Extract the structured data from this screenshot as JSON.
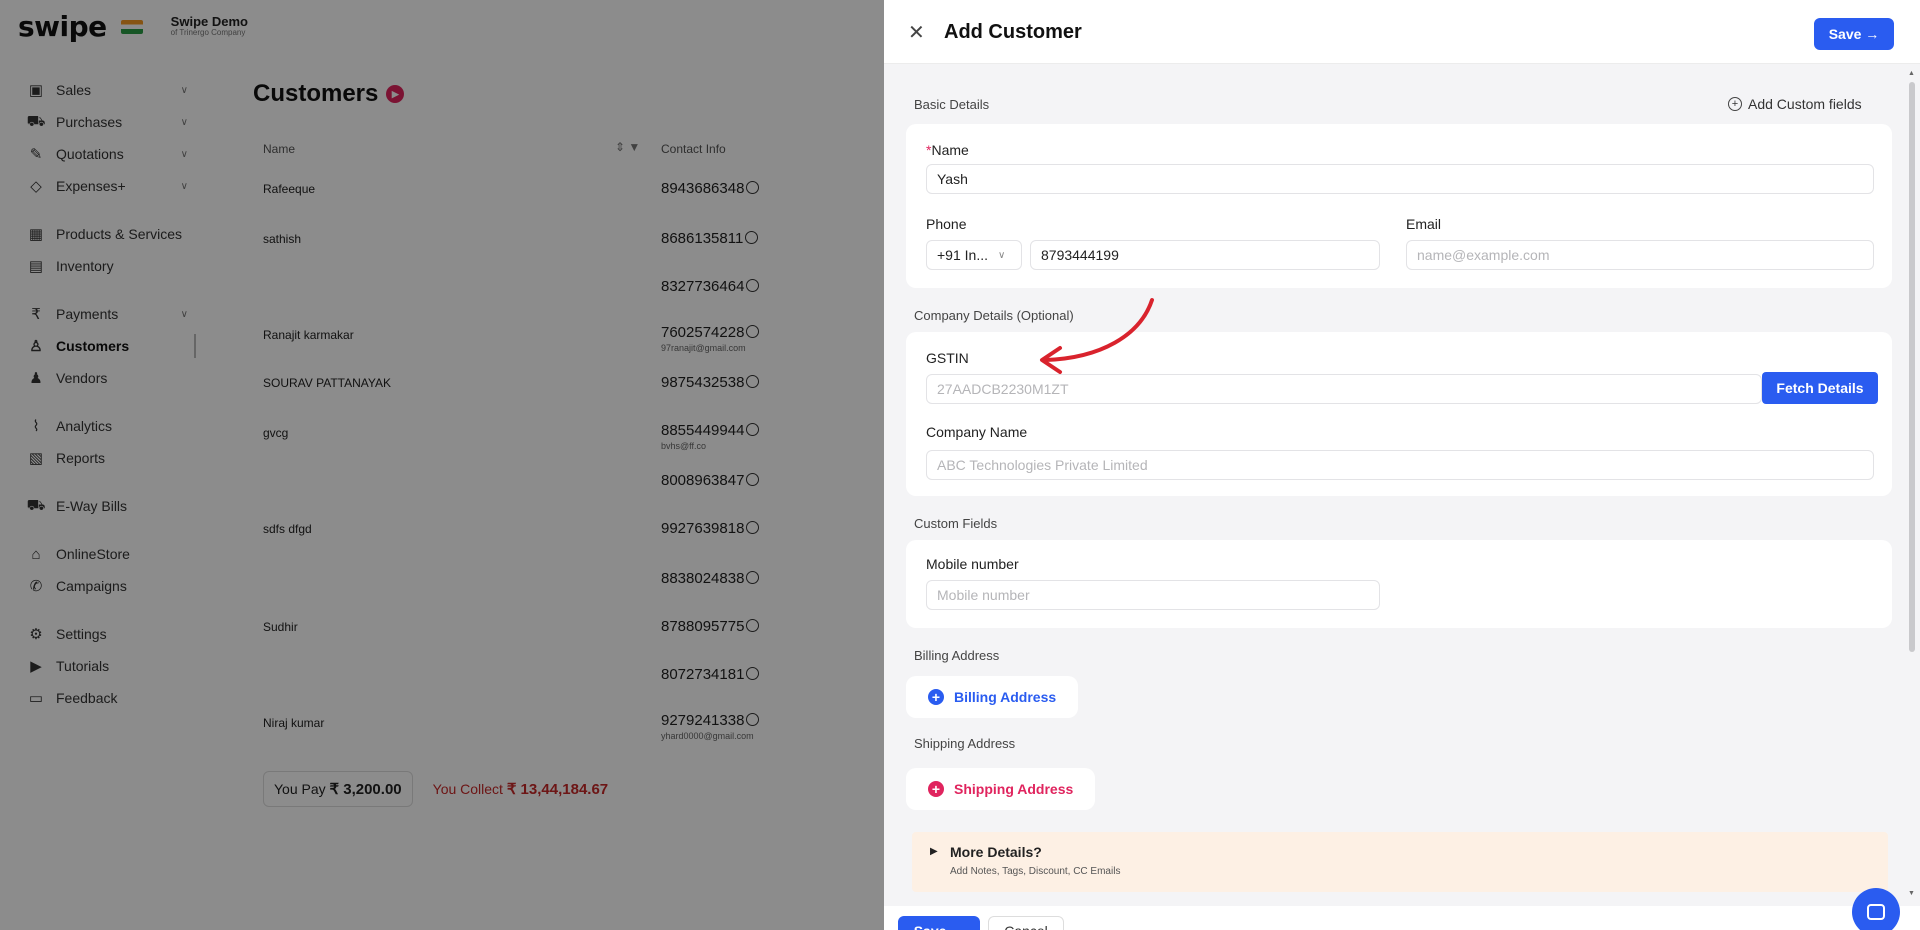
{
  "brand": {
    "logo": "swipe",
    "org_name": "Swipe Demo",
    "org_sub": "of Trinergo Company"
  },
  "sidebar": {
    "groups": [
      [
        {
          "label": "Sales",
          "icon": "sales-icon",
          "chev": true
        },
        {
          "label": "Purchases",
          "icon": "cart-icon",
          "chev": true
        },
        {
          "label": "Quotations",
          "icon": "pen-icon",
          "chev": true
        },
        {
          "label": "Expenses+",
          "icon": "tag-icon",
          "chev": true
        }
      ],
      [
        {
          "label": "Products & Services",
          "icon": "box-icon",
          "chev": false
        },
        {
          "label": "Inventory",
          "icon": "inventory-icon",
          "chev": false
        }
      ],
      [
        {
          "label": "Payments",
          "icon": "rupee-icon",
          "chev": true
        },
        {
          "label": "Customers",
          "icon": "user-icon",
          "chev": false,
          "active": true
        },
        {
          "label": "Vendors",
          "icon": "users-icon",
          "chev": false
        }
      ],
      [
        {
          "label": "Analytics",
          "icon": "chart-icon",
          "chev": false
        },
        {
          "label": "Reports",
          "icon": "report-icon",
          "chev": false
        }
      ],
      [
        {
          "label": "E-Way Bills",
          "icon": "truck-icon",
          "chev": false
        }
      ],
      [
        {
          "label": "OnlineStore",
          "icon": "store-icon",
          "chev": false
        },
        {
          "label": "Campaigns",
          "icon": "megaphone-icon",
          "chev": false
        }
      ],
      [
        {
          "label": "Settings",
          "icon": "gear-icon",
          "chev": false
        },
        {
          "label": "Tutorials",
          "icon": "play-icon",
          "chev": false
        },
        {
          "label": "Feedback",
          "icon": "chat-icon",
          "chev": false
        }
      ]
    ]
  },
  "customers": {
    "title": "Customers",
    "col_name": "Name",
    "col_contact": "Contact Info",
    "rows": [
      {
        "name": "Rafeeque",
        "phone": "8943686348",
        "email": ""
      },
      {
        "name": "sathish",
        "phone": "8686135811",
        "email": ""
      },
      {
        "name": "",
        "phone": "8327736464",
        "email": ""
      },
      {
        "name": "Ranajit karmakar",
        "phone": "7602574228",
        "email": "97ranajit@gmail.com"
      },
      {
        "name": "SOURAV PATTANAYAK",
        "phone": "9875432538",
        "email": ""
      },
      {
        "name": "gvcg",
        "phone": "8855449944",
        "email": "bvhs@ff.co"
      },
      {
        "name": "",
        "phone": "8008963847",
        "email": ""
      },
      {
        "name": "sdfs dfgd",
        "phone": "9927639818",
        "email": ""
      },
      {
        "name": "",
        "phone": "8838024838",
        "email": ""
      },
      {
        "name": "Sudhir",
        "phone": "8788095775",
        "email": ""
      },
      {
        "name": "",
        "phone": "8072734181",
        "email": ""
      },
      {
        "name": "Niraj kumar",
        "phone": "9279241338",
        "email": "yhard0000@gmail.com"
      }
    ],
    "you_pay_label": "You Pay",
    "you_pay_value": "₹ 3,200.00",
    "you_collect_label": "You Collect",
    "you_collect_value": "₹ 13,44,184.67"
  },
  "drawer": {
    "title": "Add Customer",
    "save_label": "Save →",
    "basic_details": "Basic Details",
    "add_custom_fields": "Add Custom fields",
    "name_label": "Name",
    "name_value": "Yash",
    "phone_label": "Phone",
    "country_code": "+91",
    "country_short": "In...",
    "phone_value": "8793444199",
    "email_label": "Email",
    "email_placeholder": "name@example.com",
    "company_details": "Company Details (Optional)",
    "gstin_label": "GSTIN",
    "gstin_placeholder": "27AADCB2230M1ZT",
    "fetch_label": "Fetch Details",
    "company_name_label": "Company Name",
    "company_name_placeholder": "ABC Technologies Private Limited",
    "custom_fields": "Custom Fields",
    "mobile_label": "Mobile number",
    "mobile_placeholder": "Mobile number",
    "billing_section": "Billing Address",
    "billing_button": "Billing Address",
    "shipping_section": "Shipping Address",
    "shipping_button": "Shipping Address",
    "more_title": "More Details?",
    "more_sub": "Add Notes, Tags, Discount, CC Emails",
    "footer_save": "Save →",
    "footer_cancel": "Cancel"
  },
  "colors": {
    "accent": "#2a5cf0",
    "danger": "#e0245e",
    "annotation": "#d9232d"
  }
}
